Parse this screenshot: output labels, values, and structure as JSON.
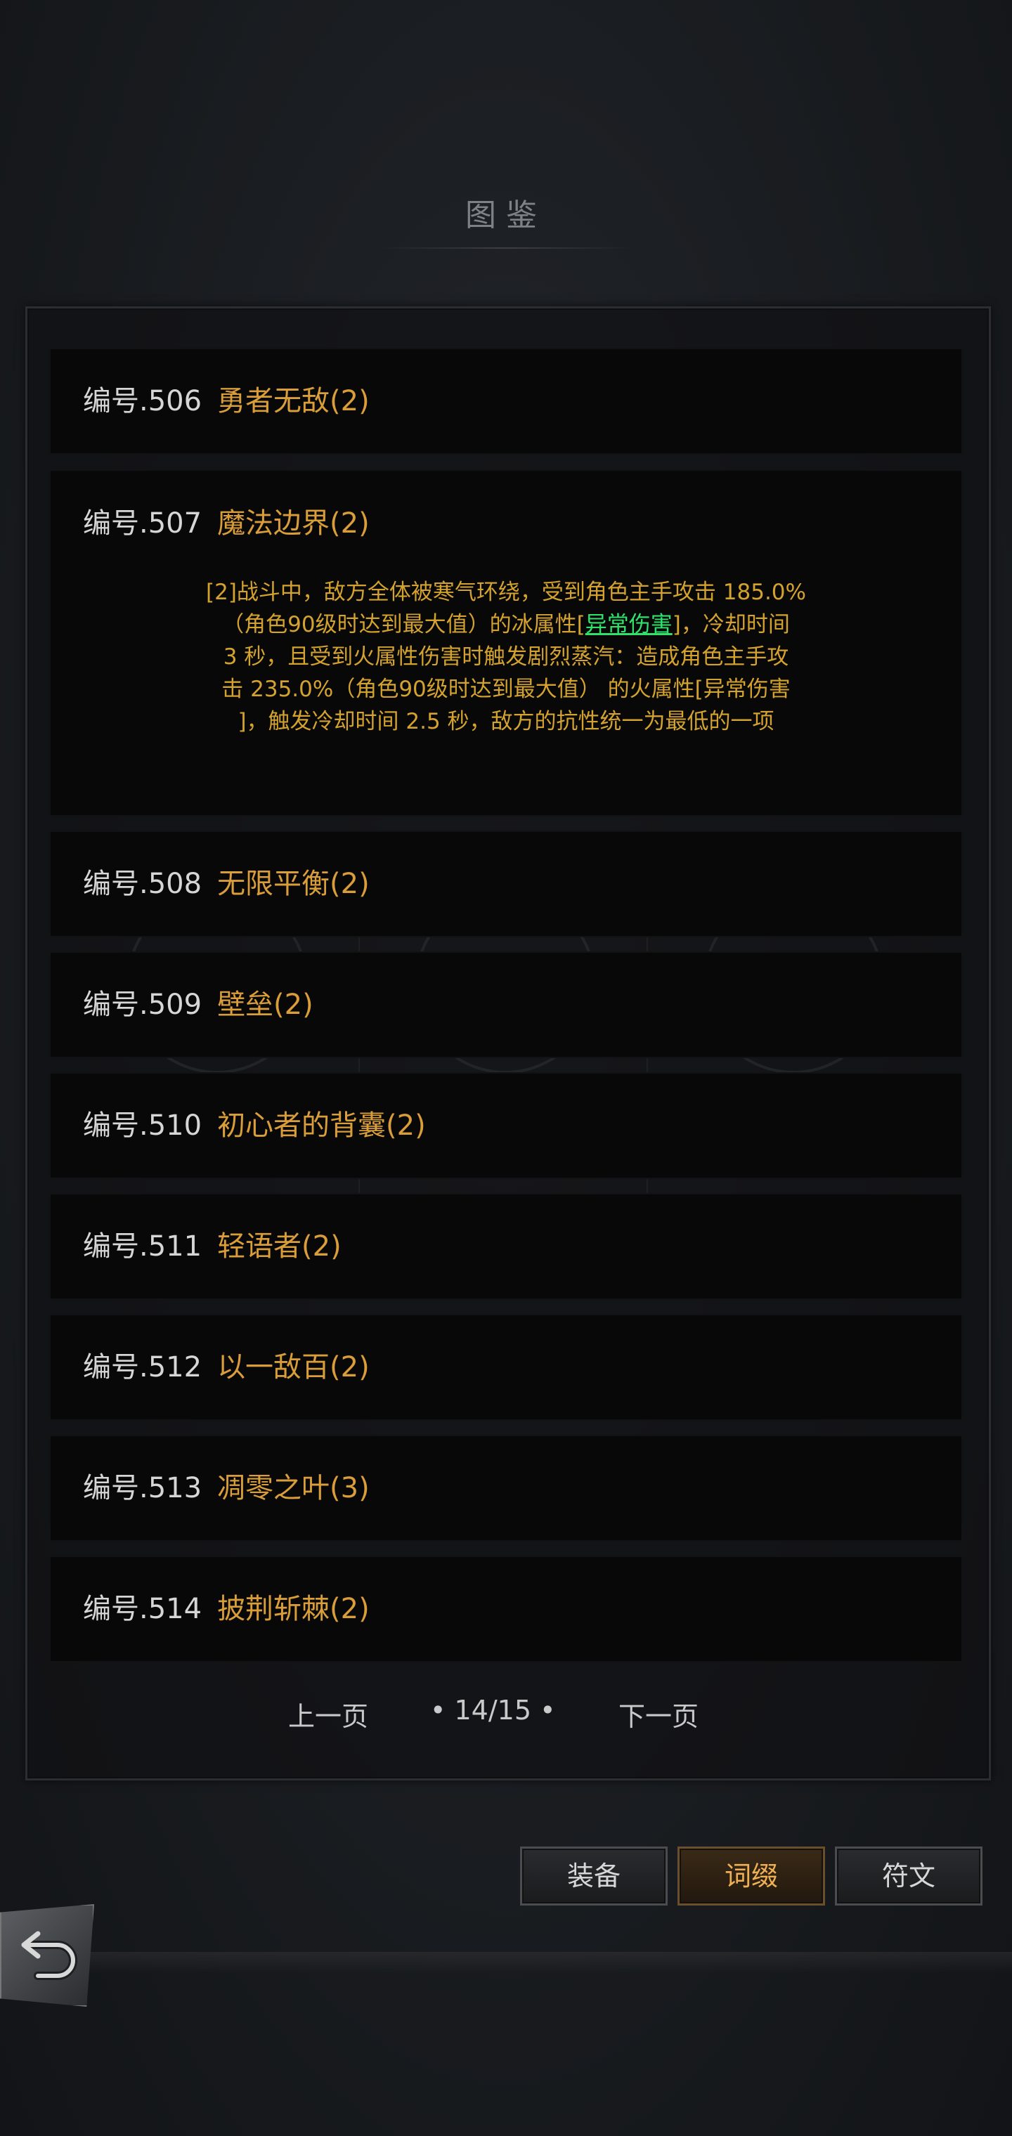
{
  "header": {
    "title": "图鉴"
  },
  "items": [
    {
      "number": "编号.506",
      "name": "勇者无敌(2)"
    },
    {
      "number": "编号.507",
      "name": "魔法边界(2)",
      "desc_lines": [
        "[2]战斗中，敌方全体被寒气环绕，受到角色主手攻击 185.0%",
        "（角色90级时达到最大值）的冰属性",
        "异常伤害",
        "，冷却时间",
        "3 秒，且受到火属性伤害时触发剧烈蒸汽：造成角色主手攻",
        "击 235.0%（角色90级时达到最大值） 的火属性[异常伤害",
        "]，触发冷却时间 2.5 秒，敌方的抗性统一为最低的一项"
      ]
    },
    {
      "number": "编号.508",
      "name": "无限平衡(2)"
    },
    {
      "number": "编号.509",
      "name": "壁垒(2)"
    },
    {
      "number": "编号.510",
      "name": "初心者的背囊(2)"
    },
    {
      "number": "编号.511",
      "name": "轻语者(2)"
    },
    {
      "number": "编号.512",
      "name": "以一敌百(2)"
    },
    {
      "number": "编号.513",
      "name": "凋零之叶(3)"
    },
    {
      "number": "编号.514",
      "name": "披荆斩棘(2)"
    }
  ],
  "pager": {
    "prev": "上一页",
    "page": "• 14/15 •",
    "next": "下一页"
  },
  "tabs": [
    {
      "label": "装备",
      "active": false
    },
    {
      "label": "词缀",
      "active": true
    },
    {
      "label": "符文",
      "active": false
    }
  ],
  "colors": {
    "accent": "#d99d39",
    "highlight": "#2fe36a",
    "description": "#d4a22e"
  },
  "icons": {
    "back": "back-arrow-icon"
  }
}
